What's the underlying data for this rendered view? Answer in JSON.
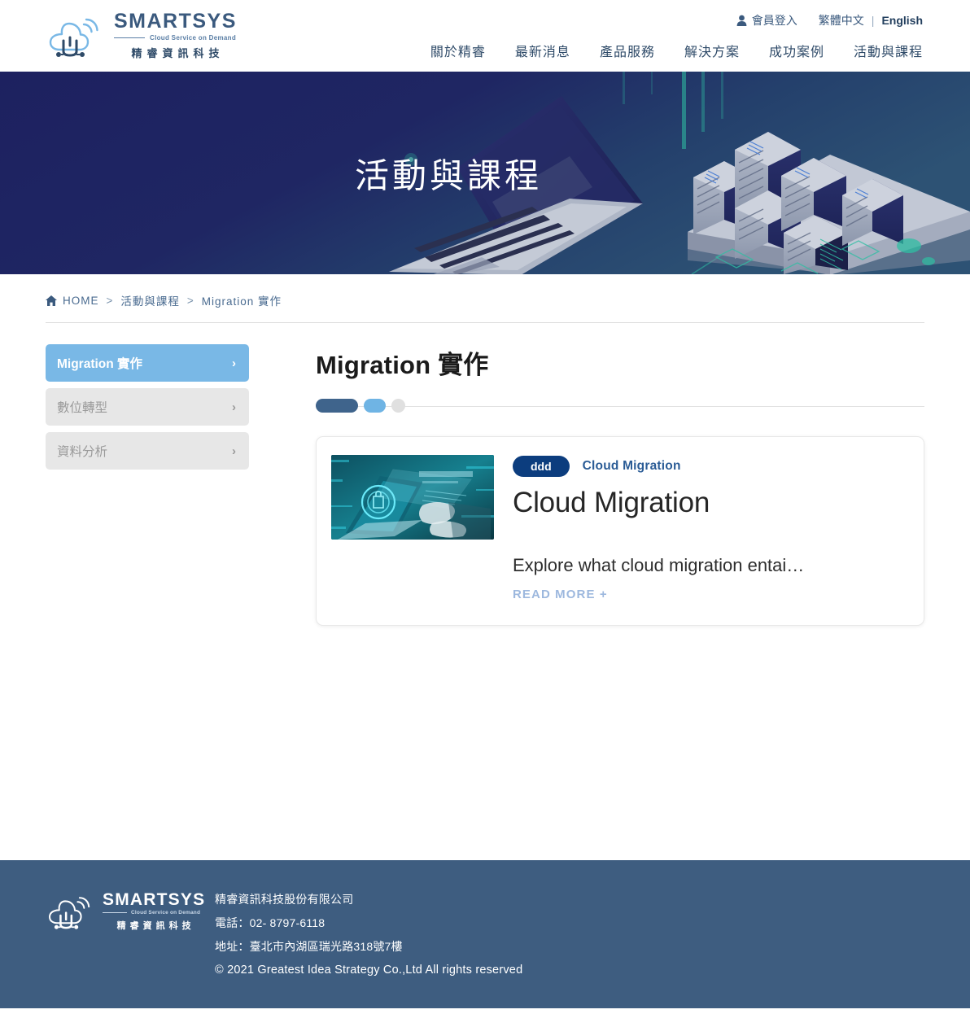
{
  "header": {
    "logo": {
      "name": "SMARTSYS",
      "tagline": "Cloud Service on Demand",
      "chinese": "精睿資訊科技",
      "icon": "cloud-logo-icon"
    },
    "utility": {
      "login_label": "會員登入",
      "login_icon": "person-icon",
      "lang_alt": "繁體中文",
      "lang_separator": "|",
      "lang_active": "English"
    },
    "nav": [
      {
        "label": "關於精睿"
      },
      {
        "label": "最新消息"
      },
      {
        "label": "產品服務"
      },
      {
        "label": "解決方案"
      },
      {
        "label": "成功案例"
      },
      {
        "label": "活動與課程"
      }
    ]
  },
  "hero": {
    "title": "活動與課程",
    "bg_color": "#1d2160",
    "accent_color": "#2fbfa3"
  },
  "breadcrumb": {
    "home_icon": "home-icon",
    "items": [
      {
        "label": "HOME"
      },
      {
        "label": "活動與課程"
      },
      {
        "label": "Migration 實作"
      }
    ],
    "separator": ">"
  },
  "sidebar": {
    "items": [
      {
        "label": "Migration 實作",
        "active": true,
        "chevron": "›"
      },
      {
        "label": "數位轉型",
        "active": false,
        "chevron": "›"
      },
      {
        "label": "資料分析",
        "active": false,
        "chevron": "›"
      }
    ],
    "active_color": "#79b8e6",
    "inactive_color": "#e7e7e7"
  },
  "main": {
    "title": "Migration 實作",
    "pager": {
      "dots": [
        {
          "state": "current",
          "color": "#3f648c"
        },
        {
          "state": "next",
          "color": "#6fb4e4"
        },
        {
          "state": "inactive",
          "color": "#e0e0e0"
        }
      ]
    },
    "cards": [
      {
        "badge": "ddd",
        "category": "Cloud Migration",
        "title": "Cloud Migration",
        "description": "Explore what cloud migration entai…",
        "read_more": "READ MORE +",
        "thumbnail_alt": "cyber-security-laptop-image"
      }
    ]
  },
  "footer": {
    "logo": {
      "name": "SMARTSYS",
      "tagline": "Cloud Service on Demand",
      "chinese": "精睿資訊科技",
      "icon": "cloud-logo-icon"
    },
    "company": "精睿資訊科技股份有限公司",
    "phone": "電話：02- 8797-6118",
    "address": "地址：臺北市內湖區瑞光路318號7樓",
    "copyright": "© 2021 Greatest Idea Strategy Co.,Ltd All rights reserved",
    "bg_color": "#3e5d80"
  }
}
